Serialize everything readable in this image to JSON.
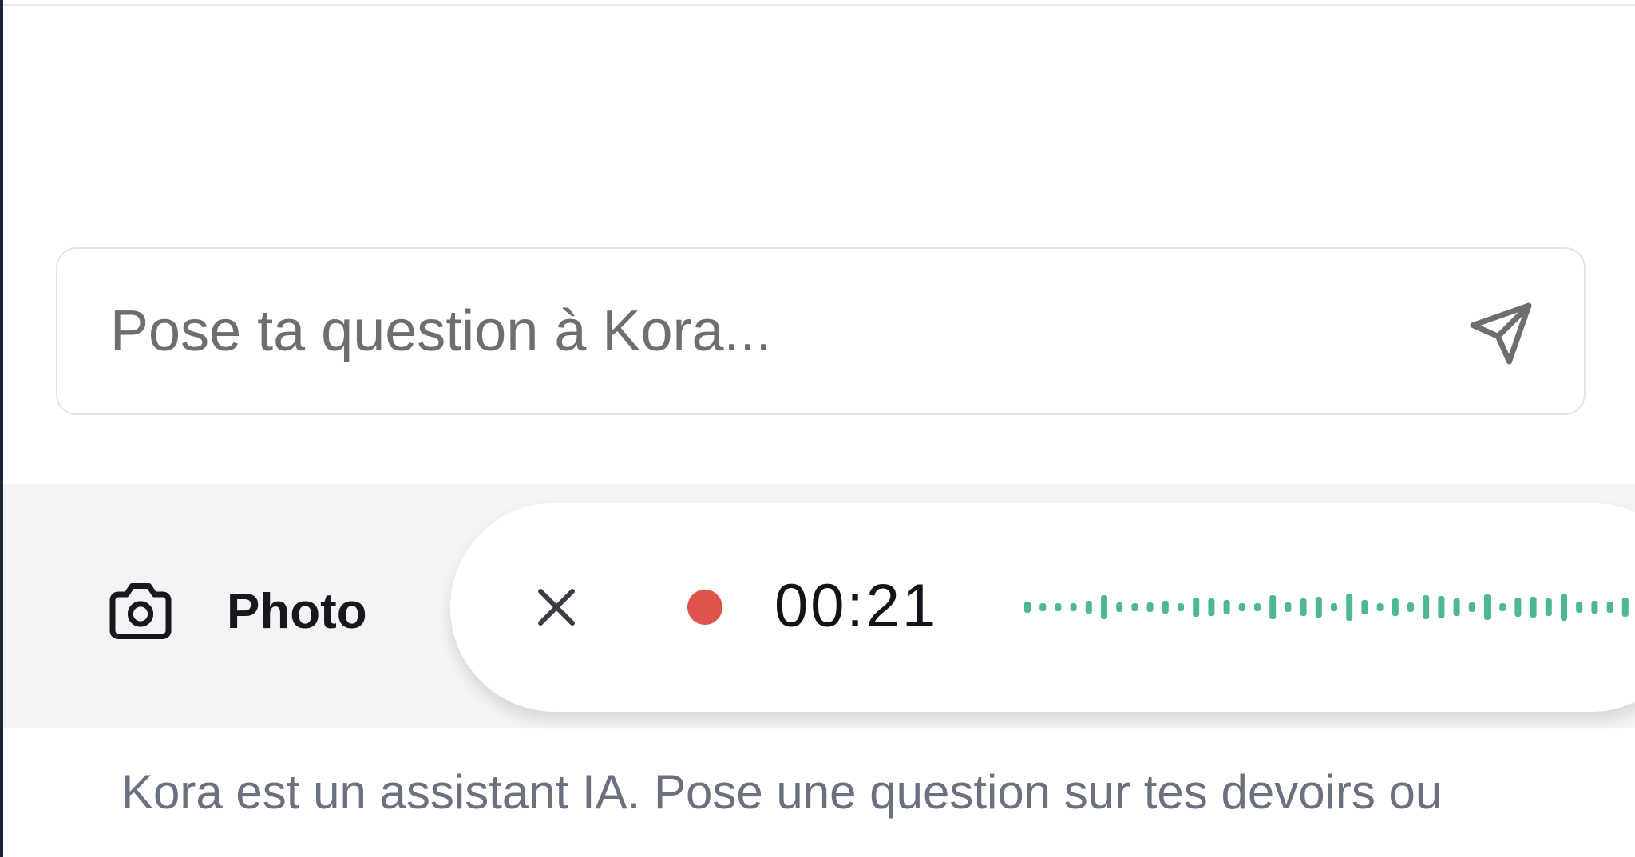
{
  "chat": {
    "placeholder": "Pose ta question à Kora..."
  },
  "icons": {
    "send": "send-icon",
    "camera": "camera-icon",
    "cancel": "close-icon"
  },
  "toolbar": {
    "photo_label": "Photo",
    "recording": {
      "timer": "00:21",
      "status_color": "#e0524c",
      "waveform_color": "#4db892"
    }
  },
  "footer": {
    "disclaimer": "Kora est un assistant IA. Pose une question sur tes devoirs ou"
  }
}
